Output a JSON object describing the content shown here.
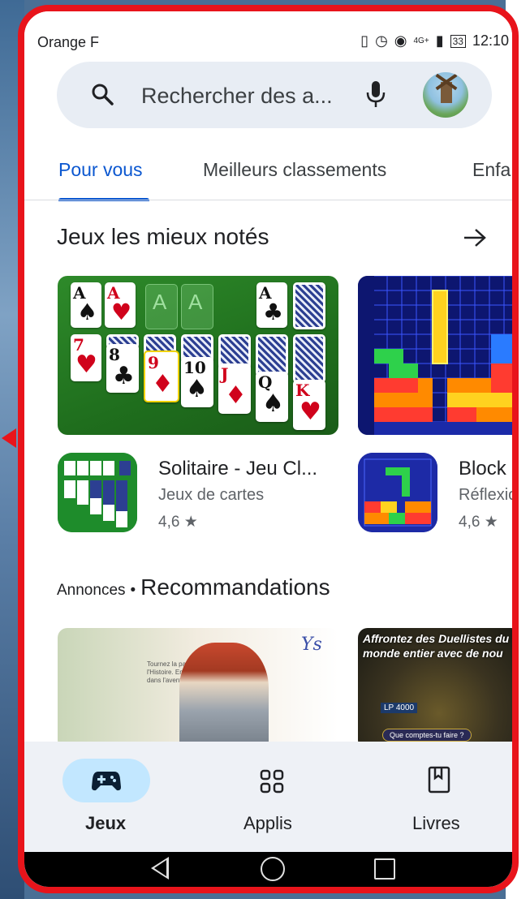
{
  "status_bar": {
    "carrier": "Orange F",
    "time": "12:10",
    "battery": "33",
    "network": "4G+"
  },
  "search": {
    "placeholder": "Rechercher des a..."
  },
  "tabs": [
    {
      "label": "Pour vous",
      "active": true
    },
    {
      "label": "Meilleurs classements",
      "active": false
    },
    {
      "label": "Enfa",
      "active": false
    }
  ],
  "section_top": {
    "title": "Jeux les mieux notés"
  },
  "apps": [
    {
      "name": "Solitaire - Jeu Cl...",
      "category": "Jeux de cartes",
      "rating": "4,6",
      "star": "★"
    },
    {
      "name": "Block",
      "category": "Réflexio",
      "rating": "4,6",
      "star": "★"
    }
  ],
  "section_ads": {
    "label": "Annonces",
    "dot": "•",
    "title": "Recommandations"
  },
  "banners": {
    "ys_logo": "Ys",
    "ys_text": "Tournez la page de l'Histoire. Embarquez dans l'aventure de Ys.",
    "duel_text": "Affrontez des Duellistes du monde entier avec de nou",
    "duel_lp": "LP 4000",
    "duel_button": "Que comptes-tu faire ?"
  },
  "bottom_nav": [
    {
      "label": "Jeux",
      "active": true
    },
    {
      "label": "Applis",
      "active": false
    },
    {
      "label": "Livres",
      "active": false
    }
  ],
  "colors": {
    "accent": "#0b57d0",
    "nav_pill": "#c2e7ff",
    "frame": "#e8141b"
  }
}
